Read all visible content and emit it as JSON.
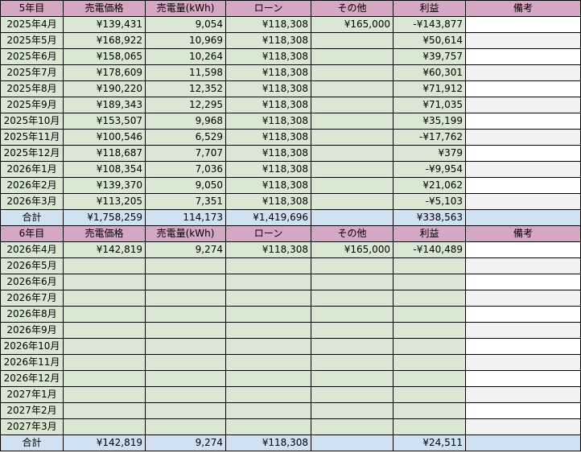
{
  "sections": [
    {
      "header": [
        "5年目",
        "売電価格",
        "売電量(kWh)",
        "ローン",
        "その他",
        "利益",
        "備考"
      ],
      "rows": [
        [
          "2025年4月",
          "¥139,431",
          "9,054",
          "¥118,308",
          "¥165,000",
          "-¥143,877",
          ""
        ],
        [
          "2025年5月",
          "¥168,922",
          "10,969",
          "¥118,308",
          "",
          "¥50,614",
          ""
        ],
        [
          "2025年6月",
          "¥158,065",
          "10,264",
          "¥118,308",
          "",
          "¥39,757",
          ""
        ],
        [
          "2025年7月",
          "¥178,609",
          "11,598",
          "¥118,308",
          "",
          "¥60,301",
          ""
        ],
        [
          "2025年8月",
          "¥190,220",
          "12,352",
          "¥118,308",
          "",
          "¥71,912",
          ""
        ],
        [
          "2025年9月",
          "¥189,343",
          "12,295",
          "¥118,308",
          "",
          "¥71,035",
          ""
        ],
        [
          "2025年10月",
          "¥153,507",
          "9,968",
          "¥118,308",
          "",
          "¥35,199",
          ""
        ],
        [
          "2025年11月",
          "¥100,546",
          "6,529",
          "¥118,308",
          "",
          "-¥17,762",
          ""
        ],
        [
          "2025年12月",
          "¥118,687",
          "7,707",
          "¥118,308",
          "",
          "¥379",
          ""
        ],
        [
          "2026年1月",
          "¥108,354",
          "7,036",
          "¥118,308",
          "",
          "-¥9,954",
          ""
        ],
        [
          "2026年2月",
          "¥139,370",
          "9,050",
          "¥118,308",
          "",
          "¥21,062",
          ""
        ],
        [
          "2026年3月",
          "¥113,205",
          "7,351",
          "¥118,308",
          "",
          "-¥5,103",
          ""
        ]
      ],
      "total": [
        "合計",
        "¥1,758,259",
        "114,173",
        "¥1,419,696",
        "",
        "¥338,563",
        ""
      ]
    },
    {
      "header": [
        "6年目",
        "売電価格",
        "売電量(kWh)",
        "ローン",
        "その他",
        "利益",
        "備考"
      ],
      "rows": [
        [
          "2026年4月",
          "¥142,819",
          "9,274",
          "¥118,308",
          "¥165,000",
          "-¥140,489",
          ""
        ],
        [
          "2026年5月",
          "",
          "",
          "",
          "",
          "",
          ""
        ],
        [
          "2026年6月",
          "",
          "",
          "",
          "",
          "",
          ""
        ],
        [
          "2026年7月",
          "",
          "",
          "",
          "",
          "",
          ""
        ],
        [
          "2026年8月",
          "",
          "",
          "",
          "",
          "",
          ""
        ],
        [
          "2026年9月",
          "",
          "",
          "",
          "",
          "",
          ""
        ],
        [
          "2026年10月",
          "",
          "",
          "",
          "",
          "",
          ""
        ],
        [
          "2026年11月",
          "",
          "",
          "",
          "",
          "",
          ""
        ],
        [
          "2026年12月",
          "",
          "",
          "",
          "",
          "",
          ""
        ],
        [
          "2027年1月",
          "",
          "",
          "",
          "",
          "",
          ""
        ],
        [
          "2027年2月",
          "",
          "",
          "",
          "",
          "",
          ""
        ],
        [
          "2027年3月",
          "",
          "",
          "",
          "",
          "",
          ""
        ]
      ],
      "total": [
        "合計",
        "¥142,819",
        "9,274",
        "¥118,308",
        "",
        "¥24,511",
        ""
      ]
    }
  ],
  "colors": {
    "header_bg": "#d6a6c5",
    "data_bg": "#d9e8d2",
    "total_bg": "#cfe1f2",
    "note_bg": "#ffffff",
    "note_alt_bg": "#f2f2f2"
  }
}
